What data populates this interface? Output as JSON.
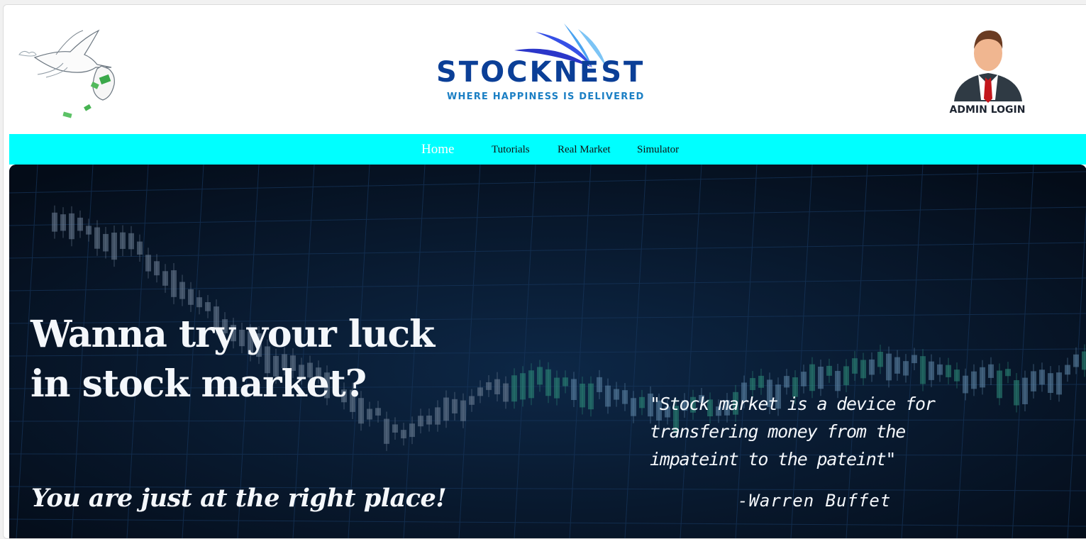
{
  "header": {
    "logo": {
      "brand": "STOCKNEST",
      "tagline": "WHERE HAPPINESS IS DELIVERED"
    },
    "stork_icon": "stork-delivering-money-icon",
    "admin": {
      "label": "ADMIN LOGIN",
      "icon": "businessman-avatar-icon"
    }
  },
  "nav": {
    "items": [
      {
        "label": "Home",
        "active": true
      },
      {
        "label": "Tutorials"
      },
      {
        "label": "Real Market"
      },
      {
        "label": "Simulator"
      }
    ]
  },
  "hero": {
    "headline_line1": "Wanna try your luck",
    "headline_line2": "in stock market?",
    "subline": "You are just at the right place!",
    "quote_line1": "\"Stock market is a device for",
    "quote_line2": "transfering money from the",
    "quote_line3": "impateint to the pateint\"",
    "quote_author": "-Warren Buffet"
  },
  "colors": {
    "nav_bg": "#00ffff",
    "hero_bg": "#071528",
    "brand_blue": "#0b3f97"
  }
}
